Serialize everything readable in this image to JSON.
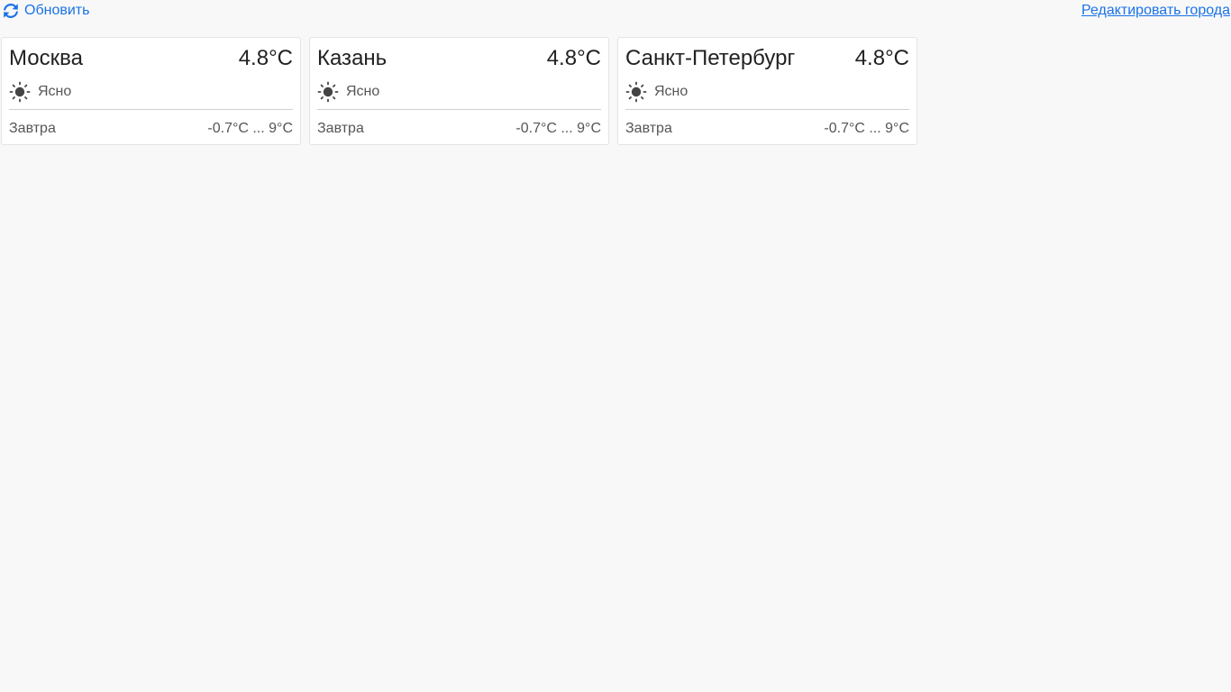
{
  "toolbar": {
    "refresh_label": "Обновить",
    "edit_label": "Редактировать города"
  },
  "colors": {
    "accent": "#1a73e8",
    "background": "#f8f8f8"
  },
  "cities": [
    {
      "name": "Москва",
      "temperature": "4.8°C",
      "condition": "Ясно",
      "condition_icon": "sun-icon",
      "tomorrow_label": "Завтра",
      "tomorrow_range": "-0.7°C ... 9°C"
    },
    {
      "name": "Казань",
      "temperature": "4.8°C",
      "condition": "Ясно",
      "condition_icon": "sun-icon",
      "tomorrow_label": "Завтра",
      "tomorrow_range": "-0.7°C ... 9°C"
    },
    {
      "name": "Санкт-Петербург",
      "temperature": "4.8°C",
      "condition": "Ясно",
      "condition_icon": "sun-icon",
      "tomorrow_label": "Завтра",
      "tomorrow_range": "-0.7°C ... 9°C"
    }
  ]
}
